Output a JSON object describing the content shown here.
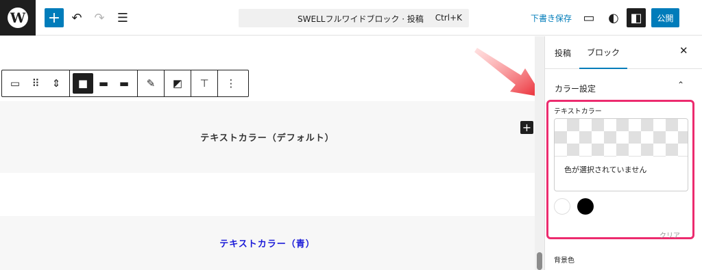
{
  "topbar": {
    "command_title": "SWELLフルワイドブロック · 投稿",
    "command_shortcut": "Ctrl+K",
    "draft_label": "下書き保存",
    "publish_label": "公開",
    "wp_logo_letter": "W",
    "add_symbol": "+",
    "undo_symbol": "↶",
    "redo_symbol": "↷",
    "list_symbol": "☰",
    "view_symbol": "▭",
    "style_symbol": "◐",
    "settings_symbol": "◧"
  },
  "block_toolbar": {
    "icons": [
      "block-type-icon",
      "drag-handle-icon",
      "move-up-down-icon",
      "align-contentwidth-icon",
      "align-wide-icon",
      "align-full-icon",
      "edit-pencil-icon",
      "fullheight-icon",
      "align-top-icon",
      "more-options-icon"
    ],
    "glyphs": [
      "▭",
      "⠿",
      "⇕",
      "■",
      "▬",
      "▬",
      "✎",
      "◩",
      "⊤",
      "⋮"
    ]
  },
  "canvas": {
    "band1_text": "テキストカラー（デフォルト）",
    "band2_text": "テキストカラー（青）",
    "insert_symbol": "+"
  },
  "sidebar": {
    "tab_post": "投稿",
    "tab_block": "ブロック",
    "close_symbol": "✕",
    "panel_title": "カラー設定",
    "chevron_symbol": "⌃",
    "text_color_label": "テキストカラー",
    "no_color_text": "色が選択されていません",
    "clear_label": "クリア",
    "bg_color_label": "背景色"
  },
  "colors": {
    "accent": "#007cba",
    "highlight": "#ec2b6e",
    "blue_text": "#1a1ad8",
    "arrow": "#e8202a"
  }
}
